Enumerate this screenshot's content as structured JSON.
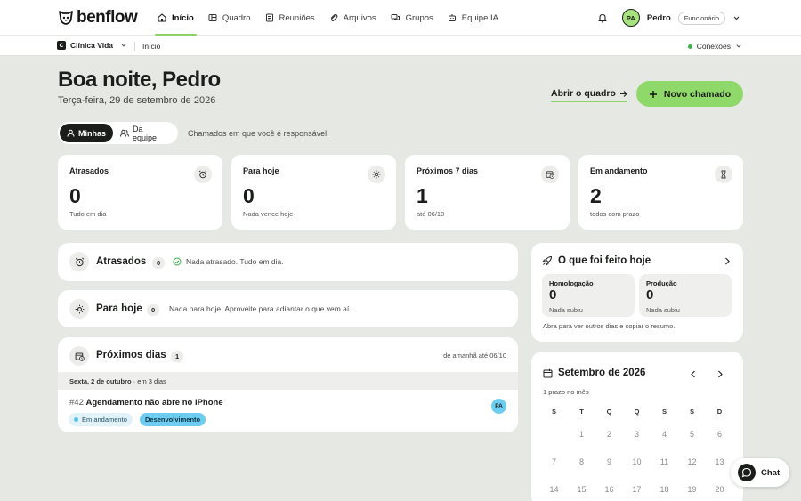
{
  "brand": {
    "name": "benflow"
  },
  "nav": {
    "tabs": [
      {
        "label": "Início",
        "icon": "home-icon"
      },
      {
        "label": "Quadro",
        "icon": "board-icon"
      },
      {
        "label": "Reuniões",
        "icon": "meetings-icon"
      },
      {
        "label": "Arquivos",
        "icon": "files-icon"
      },
      {
        "label": "Grupos",
        "icon": "groups-icon"
      },
      {
        "label": "Equipe IA",
        "icon": "ai-team-icon"
      }
    ],
    "active_tab": "Início",
    "user": {
      "initials": "PA",
      "name": "Pedro",
      "role": "Funcionário"
    }
  },
  "subbar": {
    "clinic_initial": "C",
    "clinic": "Clínica Vida",
    "breadcrumb": "Início",
    "connections": "Conexões"
  },
  "header": {
    "greeting": "Boa noite, Pedro",
    "date": "Terça-feira, 29 de setembro de 2026",
    "open_board": "Abrir o quadro",
    "new_ticket": "Novo chamado"
  },
  "filter": {
    "mine": "Minhas",
    "team": "Da equipe",
    "hint": "Chamados em que você é responsável."
  },
  "stats": [
    {
      "label": "Atrasados",
      "value": "0",
      "sub": "Tudo em dia",
      "icon": "alarm-icon"
    },
    {
      "label": "Para hoje",
      "value": "0",
      "sub": "Nada vence hoje",
      "icon": "sun-icon"
    },
    {
      "label": "Próximos 7 dias",
      "value": "1",
      "sub": "até 06/10",
      "icon": "calendar-clock-icon"
    },
    {
      "label": "Em andamento",
      "value": "2",
      "sub": "todos com prazo",
      "icon": "hourglass-icon"
    }
  ],
  "sections": {
    "overdue": {
      "title": "Atrasados",
      "count": "0",
      "message": "Nada atrasado. Tudo em dia."
    },
    "today": {
      "title": "Para hoje",
      "count": "0",
      "message": "Nada para hoje. Aproveite para adiantar o que vem aí."
    },
    "upcoming": {
      "title": "Próximos dias",
      "count": "1",
      "range": "de amanhã até 06/10",
      "day_label": "Sexta, 2 de outubro",
      "day_hint": "· em 3 dias",
      "ticket": {
        "id": "#42",
        "title": "Agendamento não abre no iPhone",
        "status": "Em andamento",
        "team": "Desenvolvimento",
        "assignee": "PA"
      }
    }
  },
  "done_today": {
    "title": "O que foi feito hoje",
    "boxes": [
      {
        "label": "Homologação",
        "value": "0",
        "sub": "Nada subiu"
      },
      {
        "label": "Produção",
        "value": "0",
        "sub": "Nada subiu"
      }
    ],
    "hint": "Abra para ver outros dias e copiar o resumo."
  },
  "calendar": {
    "month": "Setembro de 2026",
    "subtitle": "1 prazo no mês",
    "weekdays": [
      "S",
      "T",
      "Q",
      "Q",
      "S",
      "S",
      "D"
    ],
    "weeks": [
      [
        "",
        "1",
        "2",
        "3",
        "4",
        "5",
        "6"
      ],
      [
        "7",
        "8",
        "9",
        "10",
        "11",
        "12",
        "13"
      ],
      [
        "14",
        "15",
        "16",
        "17",
        "18",
        "19",
        "20"
      ]
    ]
  },
  "chat": {
    "label": "Chat"
  }
}
